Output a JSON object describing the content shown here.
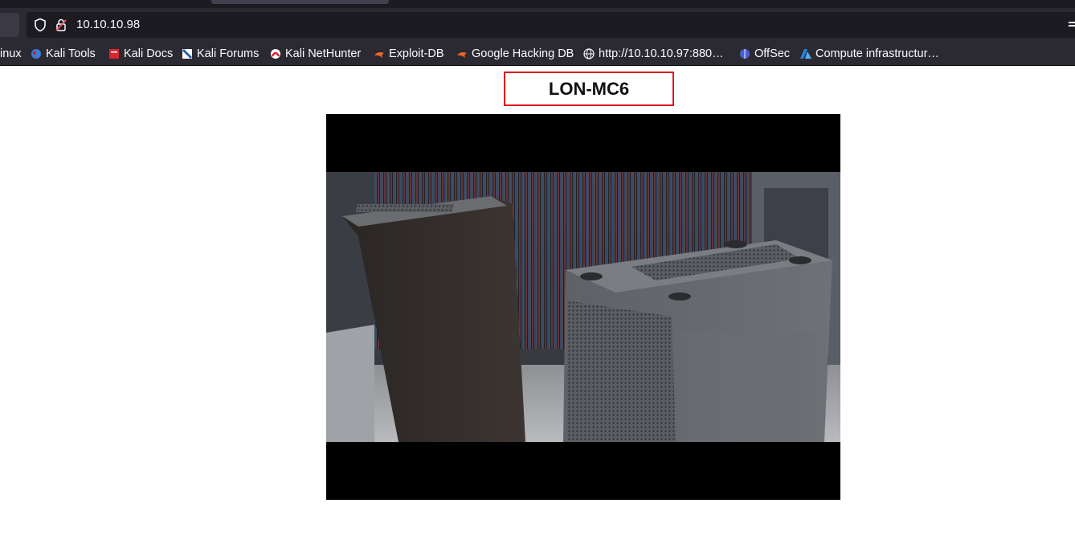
{
  "browser": {
    "url": "10.10.10.98",
    "bookmarks": [
      {
        "label": "inux",
        "icon": "kali-icon"
      },
      {
        "label": "Kali Tools",
        "icon": "kali-tools-icon"
      },
      {
        "label": "Kali Docs",
        "icon": "kali-docs-icon"
      },
      {
        "label": "Kali Forums",
        "icon": "kali-forums-icon"
      },
      {
        "label": "Kali NetHunter",
        "icon": "kali-nethunter-icon"
      },
      {
        "label": "Exploit-DB",
        "icon": "exploit-db-icon"
      },
      {
        "label": "Google Hacking DB",
        "icon": "exploit-db-icon"
      },
      {
        "label": "http://10.10.10.97:880…",
        "icon": "globe-icon"
      },
      {
        "label": "OffSec",
        "icon": "offsec-icon"
      },
      {
        "label": "Compute infrastructur…",
        "icon": "azure-icon"
      }
    ]
  },
  "page": {
    "camera_title": "LON-MC6",
    "feed_description": "security camera feed of server room with two black rack cabinets"
  },
  "colors": {
    "title_border": "#e0141e",
    "chrome_dark": "#2b2a33",
    "urlbar_bg": "#1c1b22"
  }
}
